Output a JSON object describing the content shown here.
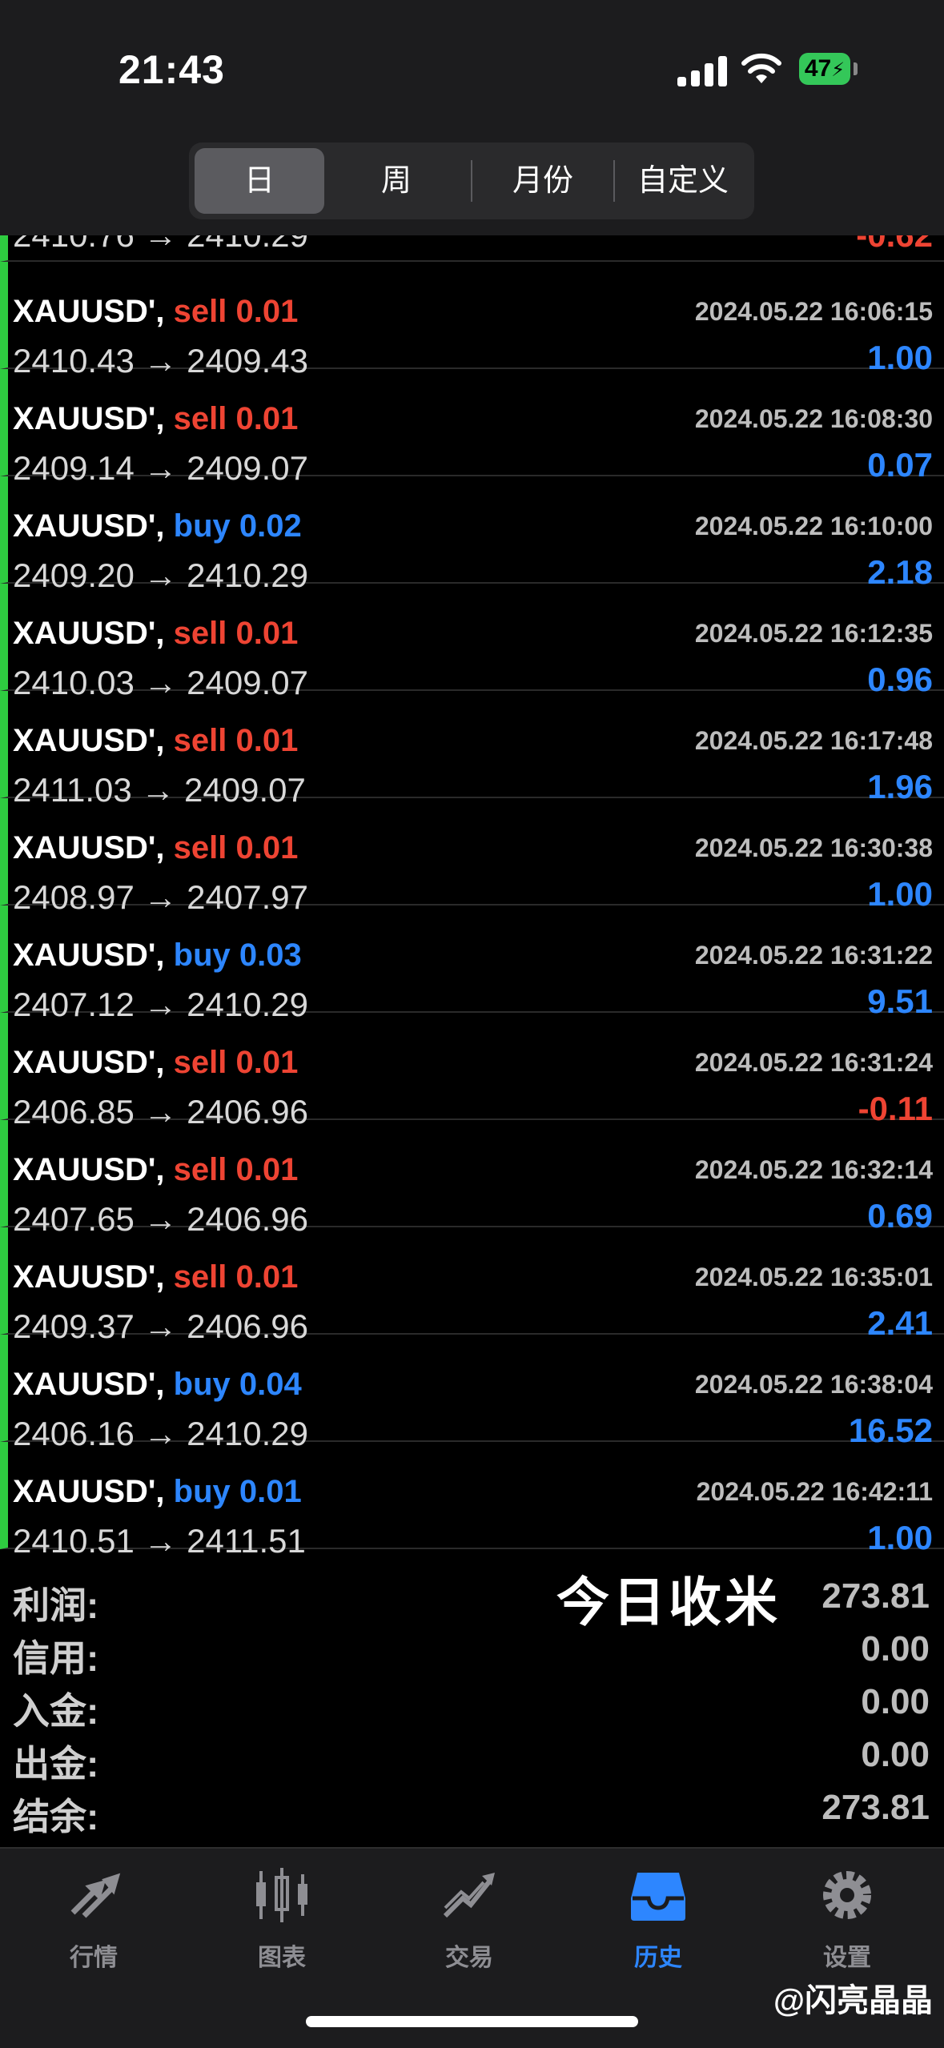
{
  "status": {
    "time": "21:43",
    "battery": "47"
  },
  "segments": [
    "日",
    "周",
    "月份",
    "自定义"
  ],
  "partial_row": {
    "prices": "2410.76 → 2410.29",
    "profit": "-0.62"
  },
  "trades": [
    {
      "symbol": "XAUUSD',",
      "side": "sell",
      "lots": "0.01",
      "time": "2024.05.22 16:06:15",
      "prices": "2410.43 → 2409.43",
      "profit": "1.00",
      "sign": "pos"
    },
    {
      "symbol": "XAUUSD',",
      "side": "sell",
      "lots": "0.01",
      "time": "2024.05.22 16:08:30",
      "prices": "2409.14 → 2409.07",
      "profit": "0.07",
      "sign": "pos"
    },
    {
      "symbol": "XAUUSD',",
      "side": "buy",
      "lots": "0.02",
      "time": "2024.05.22 16:10:00",
      "prices": "2409.20 → 2410.29",
      "profit": "2.18",
      "sign": "pos"
    },
    {
      "symbol": "XAUUSD',",
      "side": "sell",
      "lots": "0.01",
      "time": "2024.05.22 16:12:35",
      "prices": "2410.03 → 2409.07",
      "profit": "0.96",
      "sign": "pos"
    },
    {
      "symbol": "XAUUSD',",
      "side": "sell",
      "lots": "0.01",
      "time": "2024.05.22 16:17:48",
      "prices": "2411.03 → 2409.07",
      "profit": "1.96",
      "sign": "pos"
    },
    {
      "symbol": "XAUUSD',",
      "side": "sell",
      "lots": "0.01",
      "time": "2024.05.22 16:30:38",
      "prices": "2408.97 → 2407.97",
      "profit": "1.00",
      "sign": "pos"
    },
    {
      "symbol": "XAUUSD',",
      "side": "buy",
      "lots": "0.03",
      "time": "2024.05.22 16:31:22",
      "prices": "2407.12 → 2410.29",
      "profit": "9.51",
      "sign": "pos"
    },
    {
      "symbol": "XAUUSD',",
      "side": "sell",
      "lots": "0.01",
      "time": "2024.05.22 16:31:24",
      "prices": "2406.85 → 2406.96",
      "profit": "-0.11",
      "sign": "neg"
    },
    {
      "symbol": "XAUUSD',",
      "side": "sell",
      "lots": "0.01",
      "time": "2024.05.22 16:32:14",
      "prices": "2407.65 → 2406.96",
      "profit": "0.69",
      "sign": "pos"
    },
    {
      "symbol": "XAUUSD',",
      "side": "sell",
      "lots": "0.01",
      "time": "2024.05.22 16:35:01",
      "prices": "2409.37 → 2406.96",
      "profit": "2.41",
      "sign": "pos"
    },
    {
      "symbol": "XAUUSD',",
      "side": "buy",
      "lots": "0.04",
      "time": "2024.05.22 16:38:04",
      "prices": "2406.16 → 2410.29",
      "profit": "16.52",
      "sign": "pos"
    },
    {
      "symbol": "XAUUSD',",
      "side": "buy",
      "lots": "0.01",
      "time": "2024.05.22 16:42:11",
      "prices": "2410.51 → 2411.51",
      "profit": "1.00",
      "sign": "pos"
    }
  ],
  "summary": [
    {
      "label": "利润:",
      "value": "273.81"
    },
    {
      "label": "信用:",
      "value": "0.00"
    },
    {
      "label": "入金:",
      "value": "0.00"
    },
    {
      "label": "出金:",
      "value": "0.00"
    },
    {
      "label": "结余:",
      "value": "273.81"
    }
  ],
  "stamp_text": "今日收米",
  "tabs": [
    {
      "label": "行情",
      "icon": "quotes-arrows-icon"
    },
    {
      "label": "图表",
      "icon": "candlestick-chart-icon"
    },
    {
      "label": "交易",
      "icon": "trade-trend-icon"
    },
    {
      "label": "历史",
      "icon": "history-inbox-icon",
      "active": true
    },
    {
      "label": "设置",
      "icon": "gear-icon"
    }
  ],
  "watermark": "@闪亮晶晶",
  "colors": {
    "sell": "#ee4433",
    "buy": "#2d86ff",
    "accent": "#2d86ff",
    "row_marker": "#2ecc40"
  }
}
